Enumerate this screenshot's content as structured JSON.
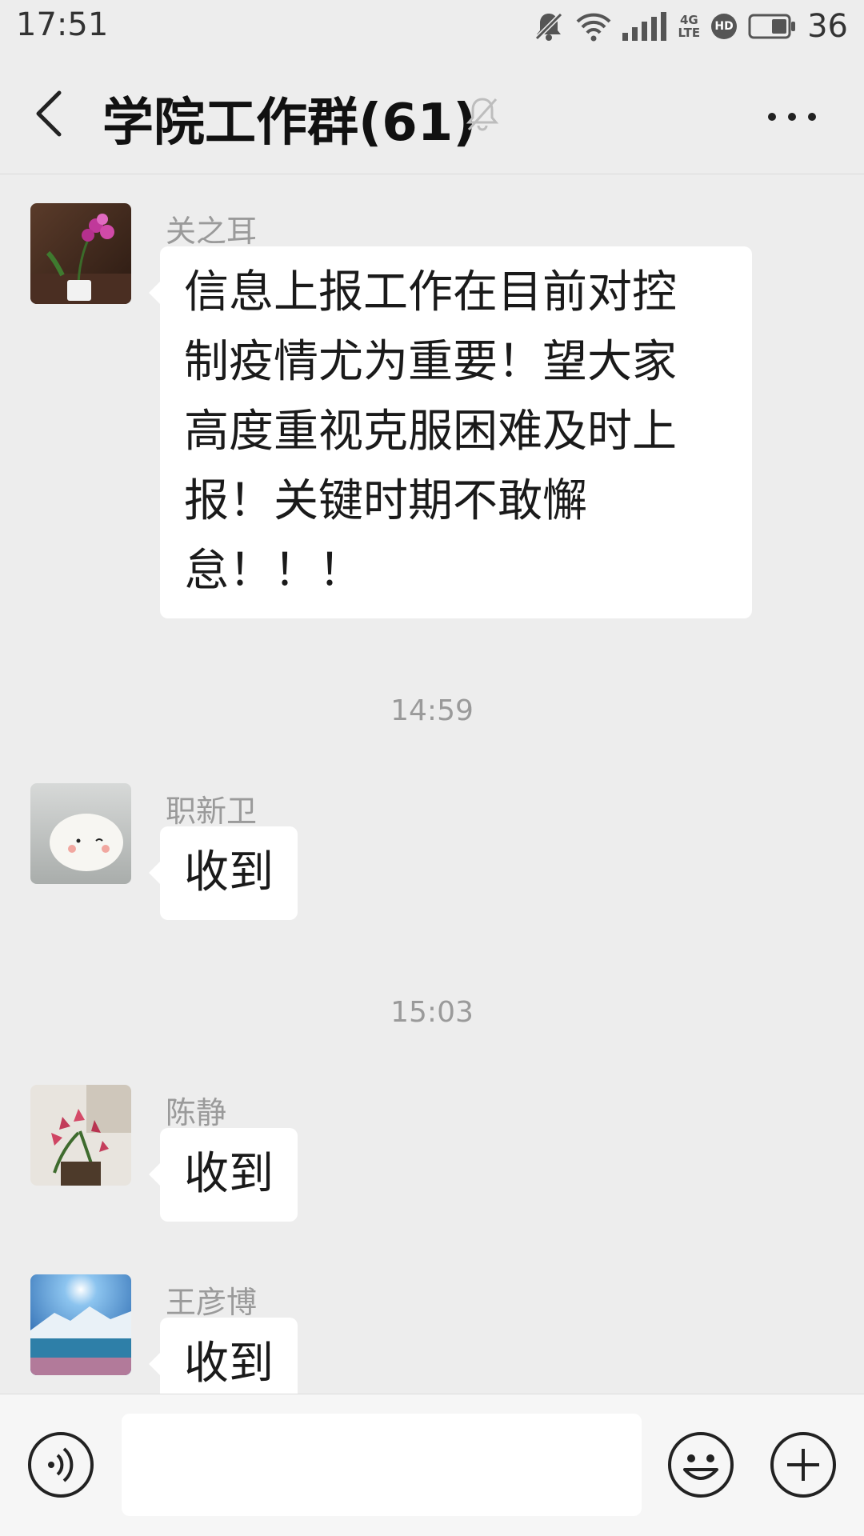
{
  "status_bar": {
    "time": "17:51",
    "network_label": "4G",
    "network_sub": "LTE",
    "hd_label": "HD",
    "battery_level": "36"
  },
  "header": {
    "title": "学院工作群(61)",
    "muted": true
  },
  "messages": [
    {
      "sender": "关之耳",
      "avatar": "orchid-photo",
      "lines": [
        "信息上报工作在目前对控",
        "制疫情尤为重要！望大家",
        "高度重视克服困难及时上",
        "报！关键时期不敢懈",
        "怠！！！"
      ]
    },
    {
      "timestamp": "14:59"
    },
    {
      "sender": "职新卫",
      "avatar": "mochi-photo",
      "lines": [
        "收到"
      ]
    },
    {
      "timestamp": "15:03"
    },
    {
      "sender": "陈静",
      "avatar": "lily-photo",
      "lines": [
        "收到"
      ]
    },
    {
      "sender": "王彦博",
      "avatar": "lake-mountain-photo",
      "lines": [
        "收到"
      ]
    }
  ],
  "input_bar": {
    "value": "",
    "placeholder": ""
  },
  "colors": {
    "background": "#ededed",
    "bubble": "#ffffff",
    "meta_text": "#9a9a9a"
  }
}
